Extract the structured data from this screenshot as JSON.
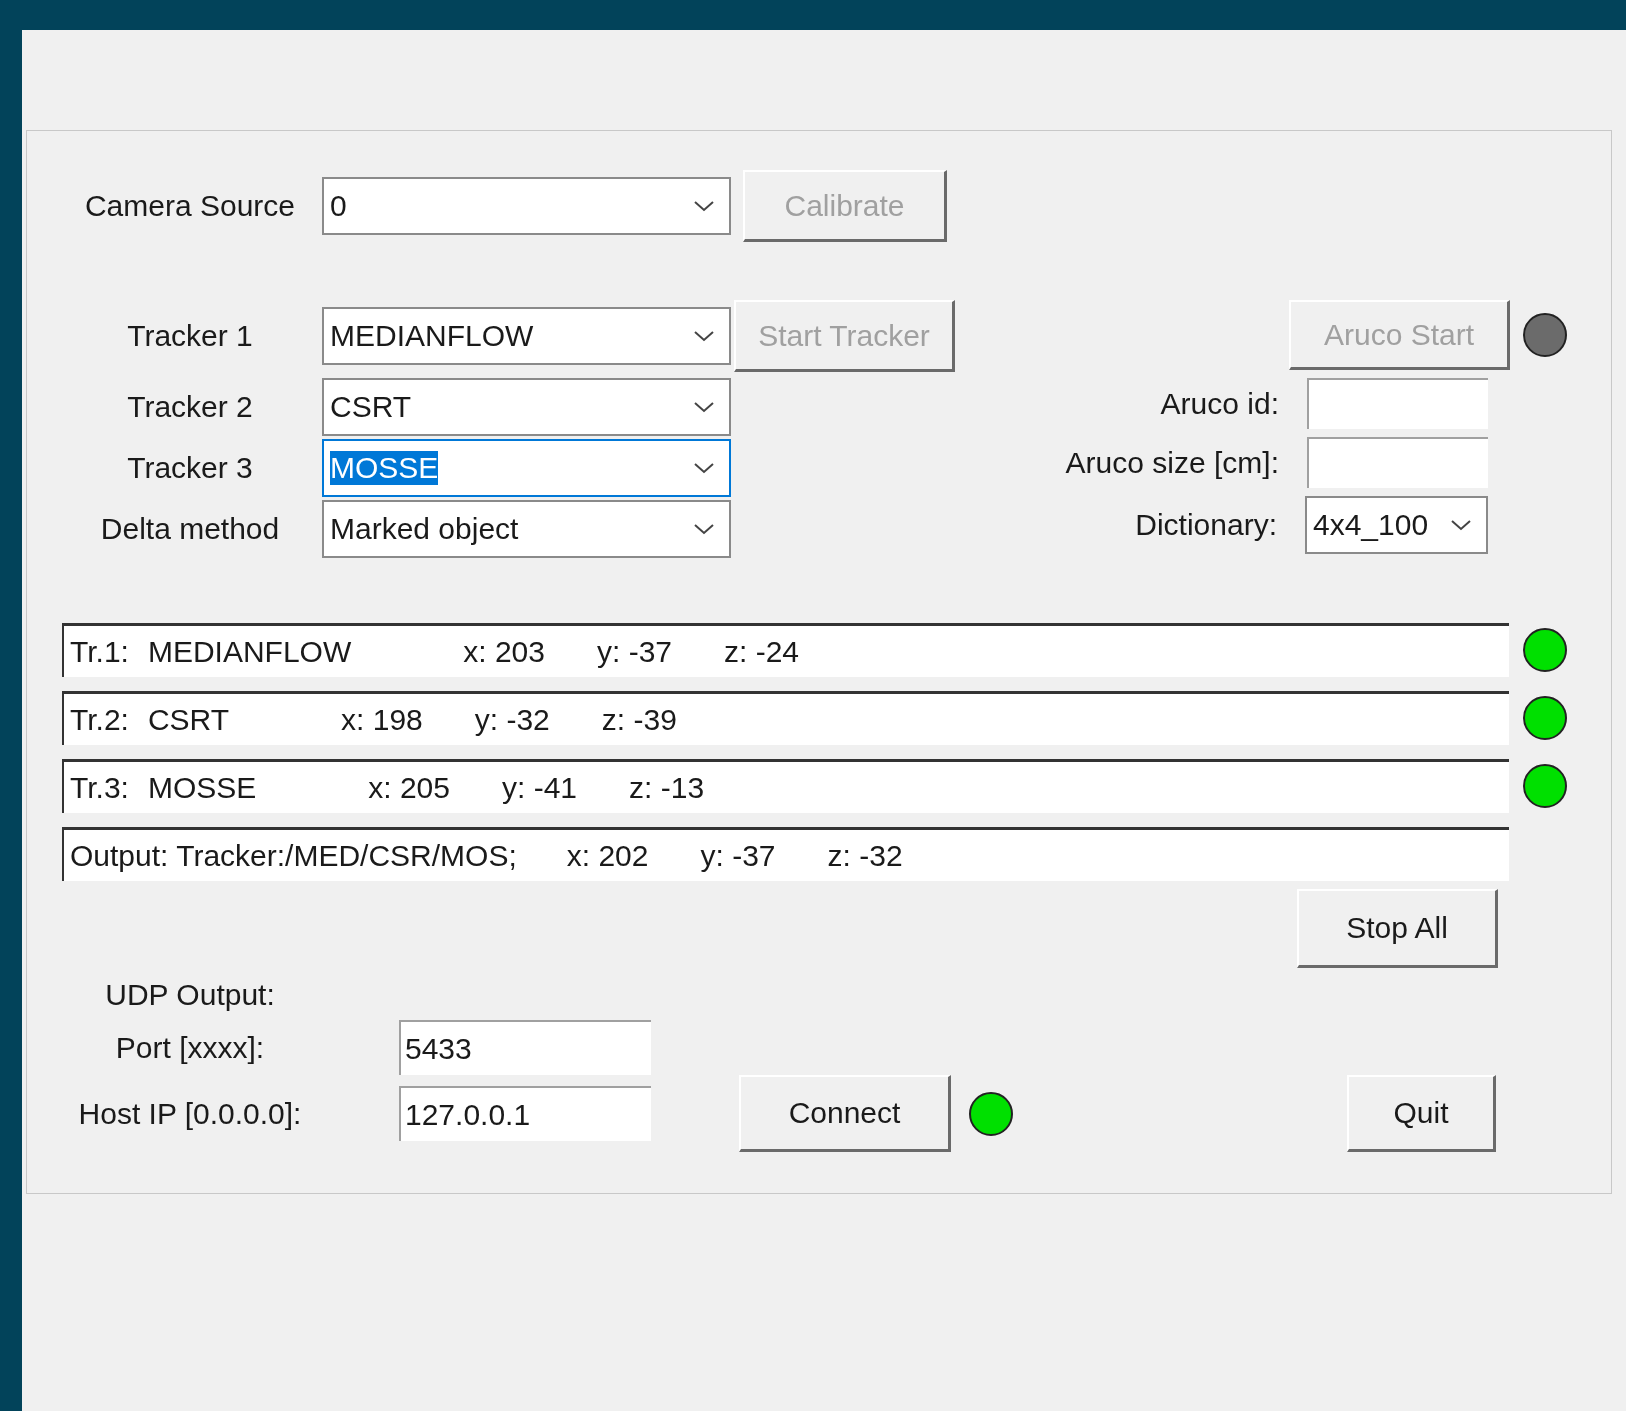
{
  "camera_source": {
    "label": "Camera Source",
    "value": "0"
  },
  "calibrate_button": {
    "label": "Calibrate",
    "disabled": true
  },
  "trackers": [
    {
      "label": "Tracker 1",
      "value": "MEDIANFLOW",
      "focused": false
    },
    {
      "label": "Tracker 2",
      "value": "CSRT",
      "focused": false
    },
    {
      "label": "Tracker 3",
      "value": "MOSSE",
      "focused": true
    }
  ],
  "delta_method": {
    "label": "Delta method",
    "value": "Marked object",
    "focused": false
  },
  "start_tracker_button": {
    "label": "Start Tracker",
    "disabled": true
  },
  "aruco": {
    "start_button": {
      "label": "Aruco Start",
      "disabled": true
    },
    "indicator": {
      "color": "#6b6b6b"
    },
    "id_label": "Aruco id:",
    "size_label": "Aruco size [cm]:",
    "dictionary_label": "Dictionary:",
    "dictionary_value": "4x4_100"
  },
  "readouts": [
    {
      "kind": "tracker",
      "label": "Tr.1:",
      "name": "MEDIANFLOW",
      "x": "x: 203",
      "y": "y: -37",
      "z": "z: -24",
      "color": "#00e000"
    },
    {
      "kind": "tracker",
      "label": "Tr.2:",
      "name": "CSRT",
      "x": "x: 198",
      "y": "y: -32",
      "z": "z: -39",
      "color": "#00e000"
    },
    {
      "kind": "tracker",
      "label": "Tr.3:",
      "name": "MOSSE",
      "x": "x: 205",
      "y": "y: -41",
      "z": "z: -13",
      "color": "#00e000"
    },
    {
      "kind": "output",
      "label": "Output: Tracker:/MED/CSR/MOS;",
      "x": "x: 202",
      "y": "y: -37",
      "z": "z: -32"
    }
  ],
  "stop_all_button": {
    "label": "Stop All",
    "disabled": false
  },
  "udp": {
    "title": "UDP Output:",
    "port_label": "Port [xxxx]:",
    "port_value": "5433",
    "host_label": "Host IP [0.0.0.0]:",
    "host_value": "127.0.0.1",
    "connect_button": {
      "label": "Connect",
      "disabled": false
    },
    "indicator": {
      "color": "#00e000"
    }
  },
  "quit_button": {
    "label": "Quit",
    "disabled": false
  }
}
